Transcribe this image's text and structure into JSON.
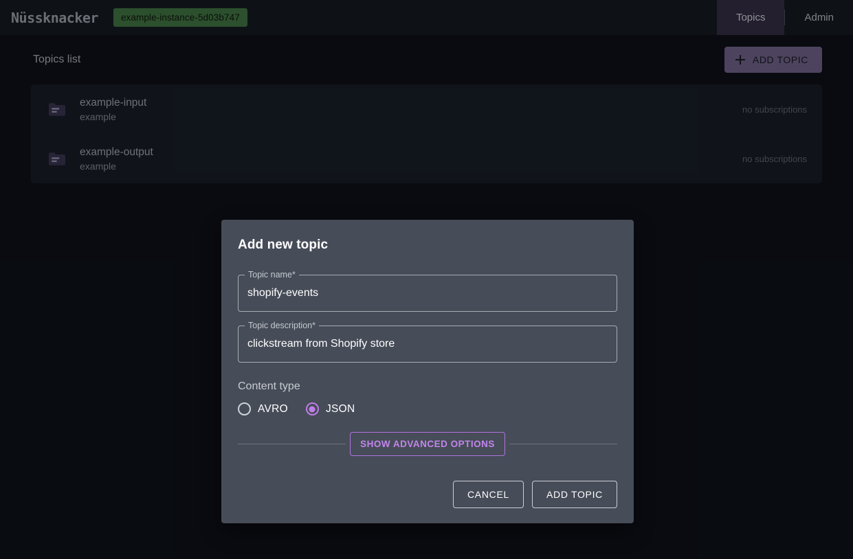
{
  "header": {
    "logo_text": "Nüssknacker",
    "instance_badge": "example-instance-5d03b747",
    "nav": [
      {
        "label": "Topics",
        "active": true
      },
      {
        "label": "Admin",
        "active": false
      }
    ]
  },
  "page": {
    "title": "Topics list",
    "add_topic_label": "ADD TOPIC",
    "plus_icon": "plus-icon"
  },
  "topics": [
    {
      "icon": "folder-icon",
      "name": "example-input",
      "subtitle": "example",
      "subscriptions": "no subscriptions"
    },
    {
      "icon": "folder-icon",
      "name": "example-output",
      "subtitle": "example",
      "subscriptions": "no subscriptions"
    }
  ],
  "modal": {
    "title": "Add new topic",
    "fields": [
      {
        "label": "Topic name",
        "required_mark": "*",
        "value": "shopify-events"
      },
      {
        "label": "Topic description",
        "required_mark": "*",
        "value": "clickstream from Shopify store"
      }
    ],
    "content_type": {
      "section_label": "Content type",
      "options": [
        {
          "label": "AVRO",
          "selected": false
        },
        {
          "label": "JSON",
          "selected": true
        }
      ]
    },
    "advanced_button": "SHOW ADVANCED OPTIONS",
    "actions": [
      {
        "label": "CANCEL"
      },
      {
        "label": "ADD TOPIC"
      }
    ]
  },
  "colors": {
    "accent_purple": "#6f6089",
    "nav_active": "#332d44",
    "badge_green": "#3f7341",
    "radio_selected": "#c07fe8",
    "advanced_border": "#b274e0",
    "page_bg": "#0d1117",
    "header_bg": "#151a22",
    "list_bg": "#171c26",
    "modal_bg": "#464c58"
  }
}
